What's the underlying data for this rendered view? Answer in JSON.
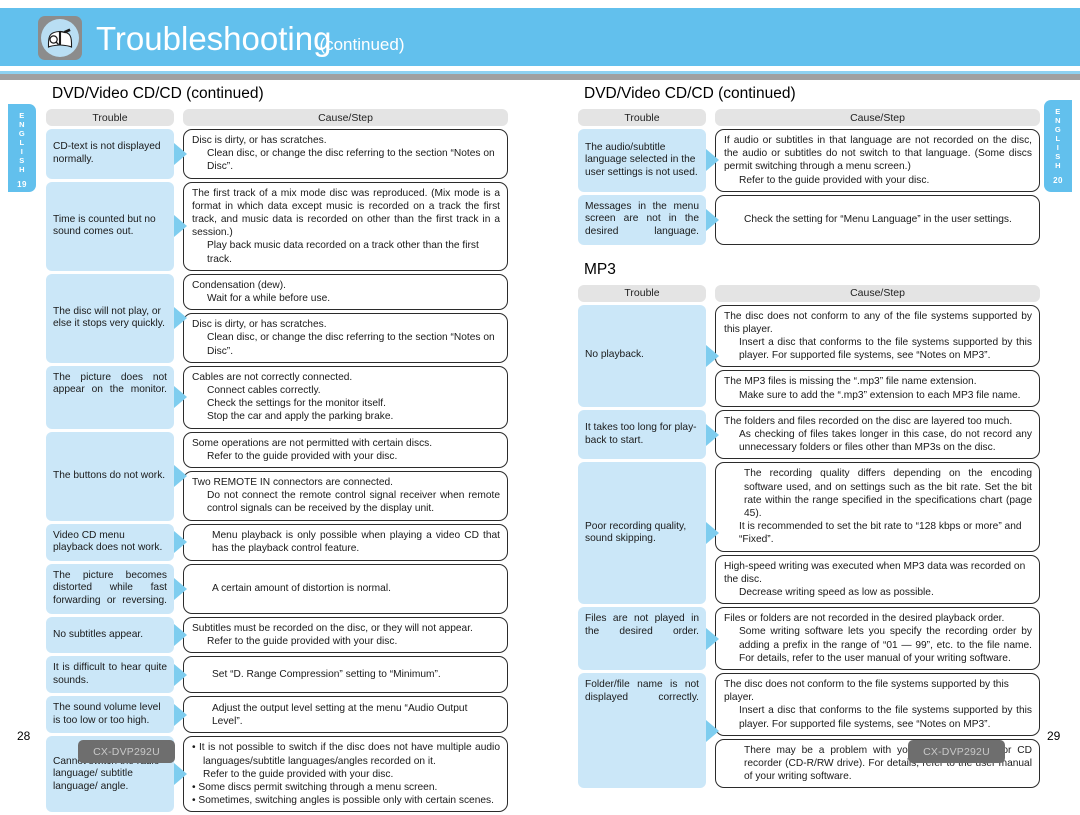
{
  "header": {
    "title": "Troubleshooting",
    "title_suffix": "(continued)",
    "icon": "troubleshooting-book-icon",
    "band_color": "#62c0ed"
  },
  "side_tabs": {
    "left": {
      "letters": [
        "E",
        "N",
        "G",
        "L",
        "I",
        "S",
        "H"
      ],
      "number": "19"
    },
    "right": {
      "letters": [
        "E",
        "N",
        "G",
        "L",
        "I",
        "S",
        "H"
      ],
      "number": "20"
    }
  },
  "table_headers": {
    "trouble": "Trouble",
    "cause": "Cause/Step"
  },
  "left_page": {
    "section_title": "DVD/Video CD/CD (continued)",
    "rows": [
      {
        "trouble": "CD-text is not displayed normally.",
        "justify": false,
        "causes": [
          {
            "lines": [
              {
                "text": "Disc is dirty, or has scratches.",
                "style": "plain"
              },
              {
                "text": "Clean disc, or change the disc referring to the section “Notes on Disc”.",
                "style": "indent"
              }
            ]
          }
        ]
      },
      {
        "trouble": "Time is counted but no sound comes out.",
        "justify": false,
        "causes": [
          {
            "lines": [
              {
                "text": "The first track of a mix mode disc was reproduced. (Mix mode is a format in which data except music is recorded on a track the first track, and music data is recorded on other than the first track in a session.)",
                "style": "justify"
              },
              {
                "text": "Play back music data recorded on a track other than the first track.",
                "style": "indent"
              }
            ]
          }
        ]
      },
      {
        "trouble": "The disc will not play, or else it stops very quickly.",
        "justify": false,
        "causes": [
          {
            "lines": [
              {
                "text": "Condensation (dew).",
                "style": "plain"
              },
              {
                "text": "Wait for a while before use.",
                "style": "indent"
              }
            ]
          },
          {
            "lines": [
              {
                "text": "Disc is dirty, or has scratches.",
                "style": "plain"
              },
              {
                "text": "Clean disc, or change the disc referring to the section “Notes on Disc”.",
                "style": "indent"
              }
            ]
          }
        ]
      },
      {
        "trouble": "The picture does not appear on the monitor.",
        "justify": true,
        "causes": [
          {
            "lines": [
              {
                "text": "Cables are not correctly connected.",
                "style": "plain"
              },
              {
                "text": "Connect cables correctly.",
                "style": "indent"
              },
              {
                "text": "Check the settings for the monitor itself.",
                "style": "indent"
              },
              {
                "text": "Stop the car and apply the parking brake.",
                "style": "indent"
              }
            ]
          }
        ]
      },
      {
        "trouble": "The buttons do not work.",
        "justify": false,
        "causes": [
          {
            "lines": [
              {
                "text": "Some operations are not permitted with certain discs.",
                "style": "plain"
              },
              {
                "text": "Refer to the guide provided with your disc.",
                "style": "indent"
              }
            ]
          },
          {
            "lines": [
              {
                "text": "Two REMOTE IN connectors are connected.",
                "style": "plain"
              },
              {
                "text": "Do not connect the remote control signal receiver when remote control signals can be received by the display unit.",
                "style": "indent-justify"
              }
            ]
          }
        ]
      },
      {
        "trouble": "Video CD menu playback does not work.",
        "justify": false,
        "causes": [
          {
            "lines": [
              {
                "text": "Menu playback is only possible when playing a video CD that has the playback control feature.",
                "style": "pad-justify"
              }
            ]
          }
        ]
      },
      {
        "trouble": "The picture becomes distorted while fast forwarding or reversing.",
        "justify": true,
        "causes": [
          {
            "lines": [
              {
                "text": "A certain amount of distortion is normal.",
                "style": "pad"
              }
            ]
          }
        ]
      },
      {
        "trouble": "No subtitles appear.",
        "justify": false,
        "causes": [
          {
            "lines": [
              {
                "text": "Subtitles must be recorded on the disc, or they will not appear.",
                "style": "plain"
              },
              {
                "text": "Refer to the guide provided with your disc.",
                "style": "indent"
              }
            ]
          }
        ]
      },
      {
        "trouble": "It is difficult to hear quite sounds.",
        "justify": true,
        "causes": [
          {
            "lines": [
              {
                "text": "Set “D. Range Compression” setting to “Minimum”.",
                "style": "pad"
              }
            ]
          }
        ]
      },
      {
        "trouble": "The sound volume level is too low or too high.",
        "justify": false,
        "causes": [
          {
            "lines": [
              {
                "text": "Adjust the output level setting at the menu “Audio Output Level”.",
                "style": "pad"
              }
            ]
          }
        ]
      },
      {
        "trouble": "Cannot switch the radio language/ subtitle language/ angle.",
        "justify": false,
        "causes": [
          {
            "lines": [
              {
                "text": "• It is not possible to switch if the disc does not have multiple audio languages/subtitle languages/angles recorded on it.",
                "style": "bullet-justify"
              },
              {
                "text": "Refer to the guide provided with your disc.",
                "style": "bullet2"
              },
              {
                "text": "• Some discs permit switching through a menu screen.",
                "style": "bullet"
              },
              {
                "text": "• Sometimes, switching angles is possible only with certain scenes.",
                "style": "bullet"
              }
            ]
          }
        ]
      }
    ]
  },
  "right_page": {
    "section_title": "DVD/Video CD/CD (continued)",
    "rows": [
      {
        "trouble": "The audio/subtitle language selected in the user settings is not used.",
        "justify": false,
        "causes": [
          {
            "lines": [
              {
                "text": "If audio or subtitles in that language are not recorded on the disc, the audio or subtitles do not switch to that language. (Some discs permit switching through a menu screen.)",
                "style": "justify"
              },
              {
                "text": "Refer to the guide provided with your disc.",
                "style": "indent"
              }
            ]
          }
        ]
      },
      {
        "trouble": "Messages in the menu screen are not in the desired language.",
        "justify": true,
        "causes": [
          {
            "lines": [
              {
                "text": "Check the setting for “Menu Language” in the user settings.",
                "style": "pad"
              }
            ]
          }
        ]
      }
    ],
    "mp3_title": "MP3",
    "mp3_rows": [
      {
        "trouble": "No playback.",
        "justify": false,
        "causes": [
          {
            "lines": [
              {
                "text": "The disc does not conform to any of the file systems supported by this player.",
                "style": "justify"
              },
              {
                "text": "Insert a disc that conforms to the file systems supported by this player. For supported file systems, see “Notes on MP3”.",
                "style": "indent-justify"
              }
            ]
          },
          {
            "lines": [
              {
                "text": "The MP3 files is missing the “.mp3” file name extension.",
                "style": "plain"
              },
              {
                "text": "Make sure to add the “.mp3” extension to each MP3 file name.",
                "style": "indent"
              }
            ]
          }
        ]
      },
      {
        "trouble": "It takes too long for play-back to start.",
        "justify": false,
        "causes": [
          {
            "lines": [
              {
                "text": "The folders and files recorded on the disc are layered too much.",
                "style": "plain"
              },
              {
                "text": "As checking of files takes longer in this case, do not record any unnecessary folders or files other than MP3s on the disc.",
                "style": "indent-justify"
              }
            ]
          }
        ]
      },
      {
        "trouble": "Poor recording quality, sound skipping.",
        "justify": false,
        "causes": [
          {
            "lines": [
              {
                "text": "The recording quality differs depending on the encoding software used, and on settings such as the bit rate. Set the bit rate within the range specified in the specifications chart (page 45).",
                "style": "pad-justify"
              },
              {
                "text": "It is recommended to set the bit rate to “128 kbps or more” and “Fixed”.",
                "style": "indent"
              }
            ]
          },
          {
            "lines": [
              {
                "text": "High-speed writing was executed when MP3 data was recorded on the disc.",
                "style": "plain"
              },
              {
                "text": "Decrease writing speed as low as possible.",
                "style": "indent"
              }
            ]
          }
        ]
      },
      {
        "trouble": "Files are not played in the desired order.",
        "justify": true,
        "causes": [
          {
            "lines": [
              {
                "text": "Files or folders are not recorded in the desired playback order.",
                "style": "plain"
              },
              {
                "text": "Some writing software lets you specify the recording order by adding a prefix in the range of “01 — 99”, etc. to the file name. For details, refer to the user manual of your writing software.",
                "style": "indent-justify"
              }
            ]
          }
        ]
      },
      {
        "trouble": "Folder/file name is not displayed correctly.",
        "justify": true,
        "causes": [
          {
            "lines": [
              {
                "text": "The disc does not conform to the file systems supported by this player.",
                "style": "plain"
              },
              {
                "text": "Insert a disc that conforms to the file systems supported by this player. For supported file systems, see “Notes on MP3”.",
                "style": "indent-justify"
              }
            ]
          },
          {
            "lines": [
              {
                "text": "There may be a problem with your writing software or CD recorder (CD-R/RW drive). For details, refer to the user manual of your writing software.",
                "style": "pad-justify"
              }
            ]
          }
        ]
      }
    ]
  },
  "footer": {
    "left_page_number": "28",
    "right_page_number": "29",
    "left_model": "CX-DVP292U",
    "right_model": "CX-DVP292U"
  }
}
